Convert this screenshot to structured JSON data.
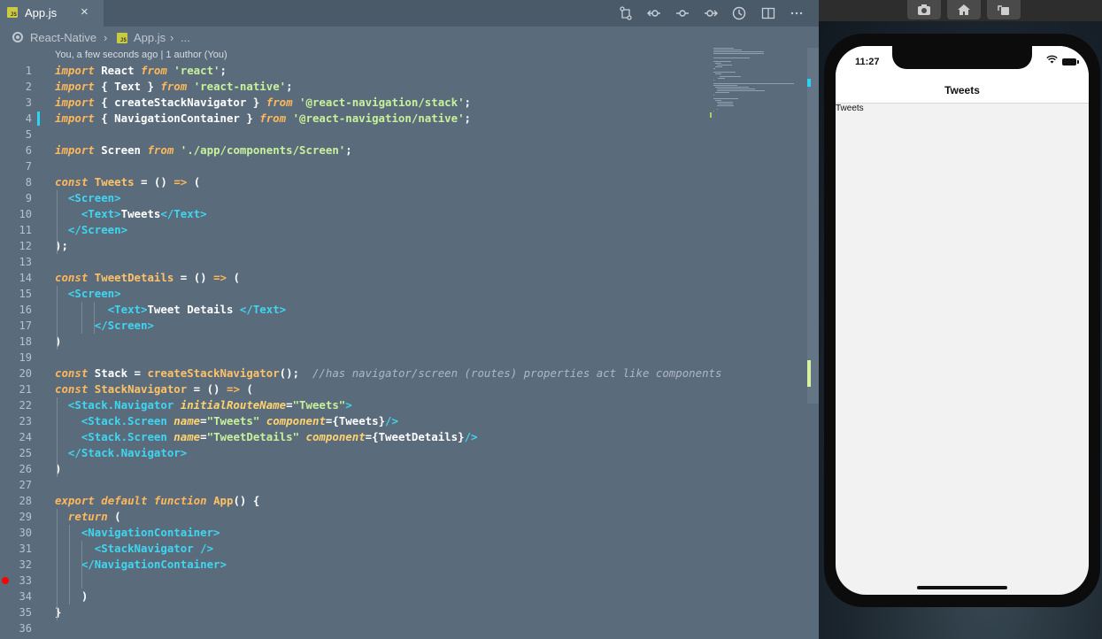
{
  "tab": {
    "title": "App.js",
    "close": "×",
    "icon": "js-file-icon"
  },
  "toolbar": {
    "icons": [
      "open-changes-icon",
      "go-back-icon",
      "git-commit-icon",
      "go-forward-icon",
      "timeline-icon",
      "split-editor-icon",
      "more-actions-icon"
    ]
  },
  "breadcrumb": {
    "root": "React-Native",
    "sep1": "›",
    "file": "App.js",
    "sep2": "›",
    "more": "..."
  },
  "blame": "You, a few seconds ago | 1 author (You)",
  "code_lines": [
    {
      "n": "1",
      "t": "import React from 'react';"
    },
    {
      "n": "2",
      "t": "import { Text } from 'react-native';"
    },
    {
      "n": "3",
      "t": "import { createStackNavigator } from '@react-navigation/stack';"
    },
    {
      "n": "4",
      "t": "import { NavigationContainer } from '@react-navigation/native';"
    },
    {
      "n": "5",
      "t": ""
    },
    {
      "n": "6",
      "t": "import Screen from './app/components/Screen';"
    },
    {
      "n": "7",
      "t": ""
    },
    {
      "n": "8",
      "t": "const Tweets = () => ("
    },
    {
      "n": "9",
      "t": "  <Screen>"
    },
    {
      "n": "10",
      "t": "    <Text>Tweets</Text>"
    },
    {
      "n": "11",
      "t": "  </Screen>"
    },
    {
      "n": "12",
      "t": ");"
    },
    {
      "n": "13",
      "t": ""
    },
    {
      "n": "14",
      "t": "const TweetDetails = () => ("
    },
    {
      "n": "15",
      "t": "  <Screen>"
    },
    {
      "n": "16",
      "t": "        <Text>Tweet Details </Text>"
    },
    {
      "n": "17",
      "t": "      </Screen>"
    },
    {
      "n": "18",
      "t": ")"
    },
    {
      "n": "19",
      "t": ""
    },
    {
      "n": "20",
      "t": "const Stack = createStackNavigator();  //has navigator/screen (routes) properties act like components"
    },
    {
      "n": "21",
      "t": "const StackNavigator = () => ("
    },
    {
      "n": "22",
      "t": "  <Stack.Navigator initialRouteName=\"Tweets\">"
    },
    {
      "n": "23",
      "t": "    <Stack.Screen name=\"Tweets\" component={Tweets}/>"
    },
    {
      "n": "24",
      "t": "    <Stack.Screen name=\"TweetDetails\" component={TweetDetails}/>"
    },
    {
      "n": "25",
      "t": "  </Stack.Navigator>"
    },
    {
      "n": "26",
      "t": ")"
    },
    {
      "n": "27",
      "t": ""
    },
    {
      "n": "28",
      "t": "export default function App() {"
    },
    {
      "n": "29",
      "t": "  return ("
    },
    {
      "n": "30",
      "t": "    <NavigationContainer>"
    },
    {
      "n": "31",
      "t": "      <StackNavigator />"
    },
    {
      "n": "32",
      "t": "    </NavigationContainer>"
    },
    {
      "n": "33",
      "t": ""
    },
    {
      "n": "34",
      "t": "    )"
    },
    {
      "n": "35",
      "t": "}"
    },
    {
      "n": "36",
      "t": ""
    }
  ],
  "simulator": {
    "toolbar": [
      "screenshot-icon",
      "home-icon",
      "rotate-icon"
    ],
    "status_time": "11:27",
    "header_title": "Tweets",
    "body_text": "Tweets"
  },
  "colors": {
    "editor_bg": "#5a6b7c",
    "keyword": "#ffb85a",
    "string": "#c8f29a",
    "tag": "#3ed6f0",
    "breakpoint": "#ff0000"
  }
}
